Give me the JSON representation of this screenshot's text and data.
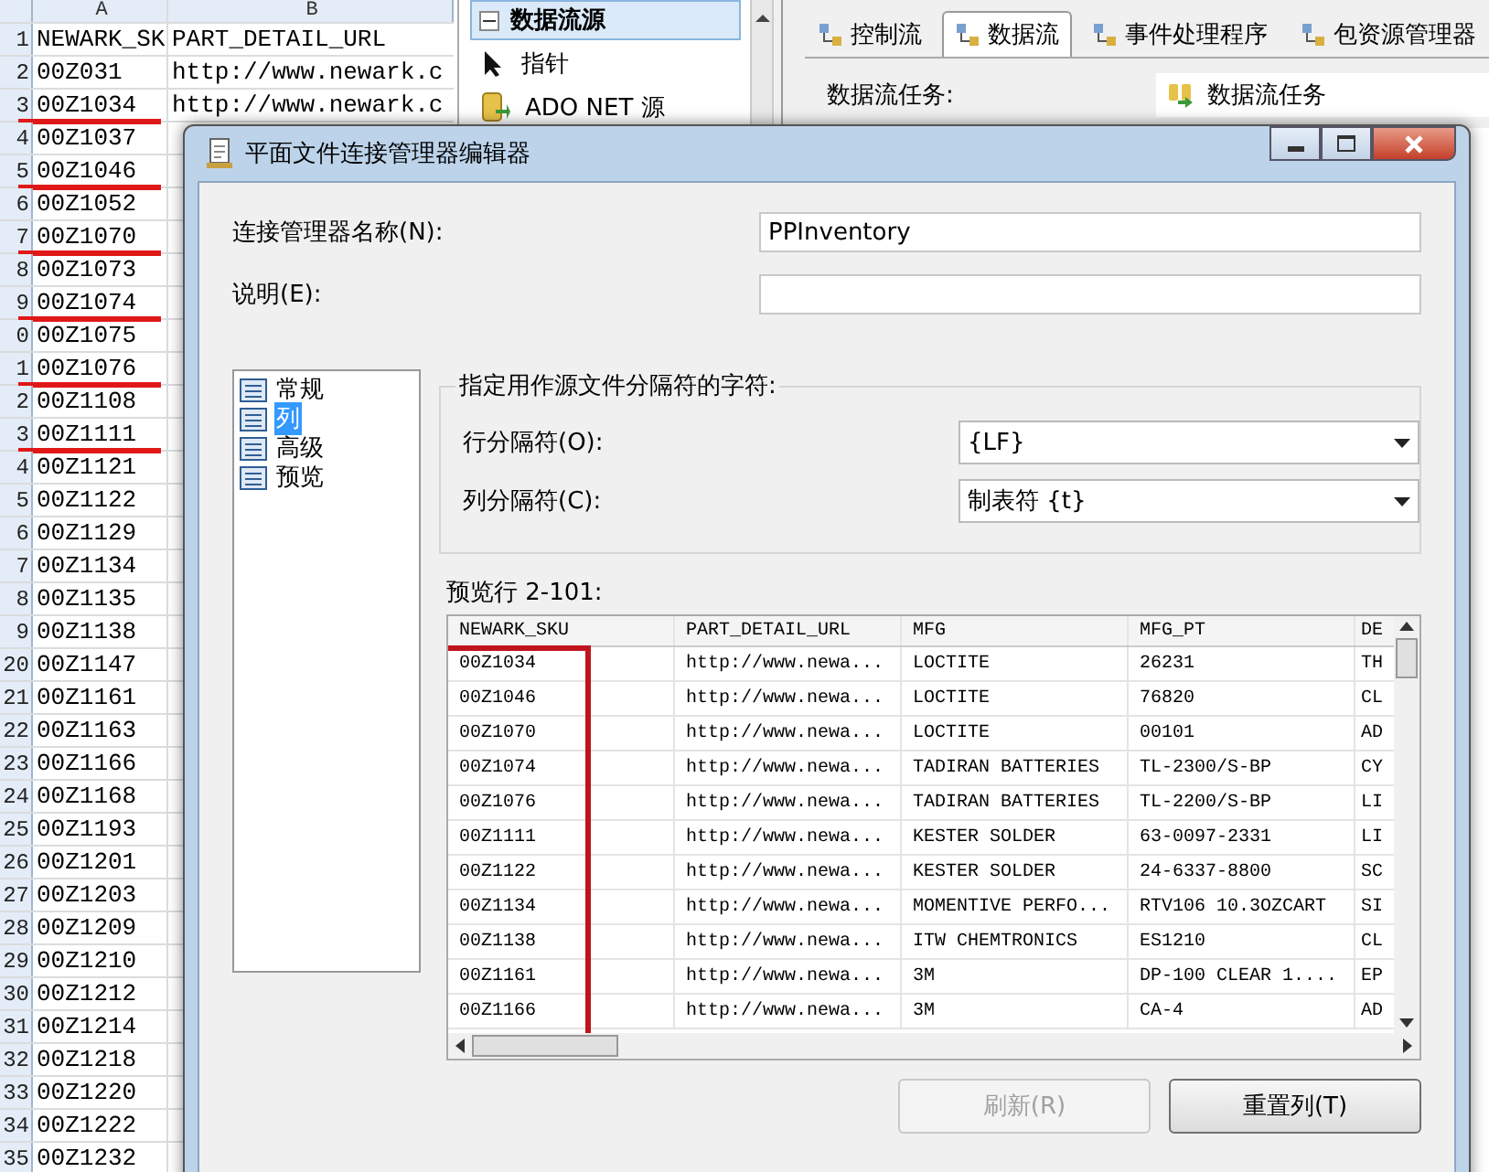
{
  "spreadsheet": {
    "columns": [
      "A",
      "B"
    ],
    "rows": [
      {
        "number": "1",
        "a": "NEWARK_SK",
        "b": "PART_DETAIL_URL",
        "marked": false
      },
      {
        "number": "2",
        "a": "00Z031",
        "b": "http://www.newark.c",
        "marked": false
      },
      {
        "number": "3",
        "a": "00Z1034",
        "b": "http://www.newark.c",
        "marked": true
      },
      {
        "number": "4",
        "a": "00Z1037",
        "marked": false
      },
      {
        "number": "5",
        "a": "00Z1046",
        "marked": true
      },
      {
        "number": "6",
        "a": "00Z1052",
        "marked": false
      },
      {
        "number": "7",
        "a": "00Z1070",
        "marked": true
      },
      {
        "number": "8",
        "a": "00Z1073",
        "marked": false
      },
      {
        "number": "9",
        "a": "00Z1074",
        "marked": true
      },
      {
        "number": "0",
        "a": "00Z1075",
        "marked": false
      },
      {
        "number": "1",
        "a": "00Z1076",
        "marked": true
      },
      {
        "number": "2",
        "a": "00Z1108",
        "marked": false
      },
      {
        "number": "3",
        "a": "00Z1111",
        "marked": true
      },
      {
        "number": "4",
        "a": "00Z1121",
        "marked": false
      },
      {
        "number": "5",
        "a": "00Z1122",
        "marked": false
      },
      {
        "number": "6",
        "a": "00Z1129",
        "marked": false
      },
      {
        "number": "7",
        "a": "00Z1134",
        "marked": false
      },
      {
        "number": "8",
        "a": "00Z1135",
        "marked": false
      },
      {
        "number": "9",
        "a": "00Z1138",
        "marked": false
      },
      {
        "number": "20",
        "a": "00Z1147",
        "marked": false
      },
      {
        "number": "21",
        "a": "00Z1161",
        "marked": false
      },
      {
        "number": "22",
        "a": "00Z1163",
        "marked": false
      },
      {
        "number": "23",
        "a": "00Z1166",
        "marked": false
      },
      {
        "number": "24",
        "a": "00Z1168",
        "marked": false
      },
      {
        "number": "25",
        "a": "00Z1193",
        "marked": false
      },
      {
        "number": "26",
        "a": "00Z1201",
        "marked": false
      },
      {
        "number": "27",
        "a": "00Z1203",
        "marked": false
      },
      {
        "number": "28",
        "a": "00Z1209",
        "marked": false
      },
      {
        "number": "29",
        "a": "00Z1210",
        "marked": false
      },
      {
        "number": "30",
        "a": "00Z1212",
        "marked": false
      },
      {
        "number": "31",
        "a": "00Z1214",
        "marked": false
      },
      {
        "number": "32",
        "a": "00Z1218",
        "marked": false
      },
      {
        "number": "33",
        "a": "00Z1220",
        "marked": false
      },
      {
        "number": "34",
        "a": "00Z1222",
        "marked": false
      },
      {
        "number": "35",
        "a": "00Z1232",
        "marked": false
      }
    ]
  },
  "toolbox": {
    "group": {
      "label": "数据流源",
      "expanded": true
    },
    "items": [
      {
        "kind": "pointer",
        "label": "指针"
      },
      {
        "kind": "source",
        "label": "ADO NET 源"
      }
    ]
  },
  "designer": {
    "tabs": [
      {
        "label": "控制流",
        "selected": false
      },
      {
        "label": "数据流",
        "selected": true
      },
      {
        "label": "事件处理程序",
        "selected": false
      },
      {
        "label": "包资源管理器",
        "selected": false
      }
    ],
    "task_label": "数据流任务:",
    "task_value": "数据流任务"
  },
  "dialog": {
    "title": "平面文件连接管理器编辑器",
    "name_label": "连接管理器名称(N):",
    "name_value": "PPInventory",
    "description_label": "说明(E):",
    "nav": [
      {
        "label": "常规",
        "selected": false
      },
      {
        "label": "列",
        "selected": true
      },
      {
        "label": "高级",
        "selected": false
      },
      {
        "label": "预览",
        "selected": false
      }
    ],
    "group_title": "指定用作源文件分隔符的字符:",
    "delimiters": [
      {
        "label": "行分隔符(O):",
        "value": "{LF}"
      },
      {
        "label": "列分隔符(C):",
        "value": "制表符 {t}"
      }
    ],
    "preview_label": "预览行 2-101:",
    "preview": {
      "columns": [
        {
          "label": "NEWARK_SKU",
          "highlighted": true
        },
        {
          "label": "PART_DETAIL_URL",
          "highlighted": false
        },
        {
          "label": "MFG",
          "highlighted": false
        },
        {
          "label": "MFG_PT",
          "highlighted": false
        },
        {
          "label": "DE",
          "highlighted": false
        }
      ],
      "rows": [
        [
          "00Z1034",
          "http://www.newa...",
          "LOCTITE",
          "26231",
          "TH"
        ],
        [
          "00Z1046",
          "http://www.newa...",
          "LOCTITE",
          "76820",
          "CL"
        ],
        [
          "00Z1070",
          "http://www.newa...",
          "LOCTITE",
          "00101",
          "AD"
        ],
        [
          "00Z1074",
          "http://www.newa...",
          "TADIRAN BATTERIES",
          "TL-2300/S-BP",
          "CY"
        ],
        [
          "00Z1076",
          "http://www.newa...",
          "TADIRAN BATTERIES",
          "TL-2200/S-BP",
          "LI"
        ],
        [
          "00Z1111",
          "http://www.newa...",
          "KESTER SOLDER",
          "63-0097-2331",
          "LI"
        ],
        [
          "00Z1122",
          "http://www.newa...",
          "KESTER SOLDER",
          "24-6337-8800",
          "SC"
        ],
        [
          "00Z1134",
          "http://www.newa...",
          "MOMENTIVE PERFO...",
          "RTV106 10.3OZCART",
          "SI"
        ],
        [
          "00Z1138",
          "http://www.newa...",
          "ITW CHEMTRONICS",
          "ES1210",
          "CL"
        ],
        [
          "00Z1161",
          "http://www.newa...",
          "3M",
          "DP-100 CLEAR 1....",
          "EP"
        ],
        [
          "00Z1166",
          "http://www.newa...",
          "3M",
          "CA-4",
          "AD"
        ]
      ]
    },
    "buttons": [
      {
        "label": "刷新(R)",
        "disabled": true
      },
      {
        "label": "重置列(T)",
        "disabled": false
      }
    ]
  }
}
